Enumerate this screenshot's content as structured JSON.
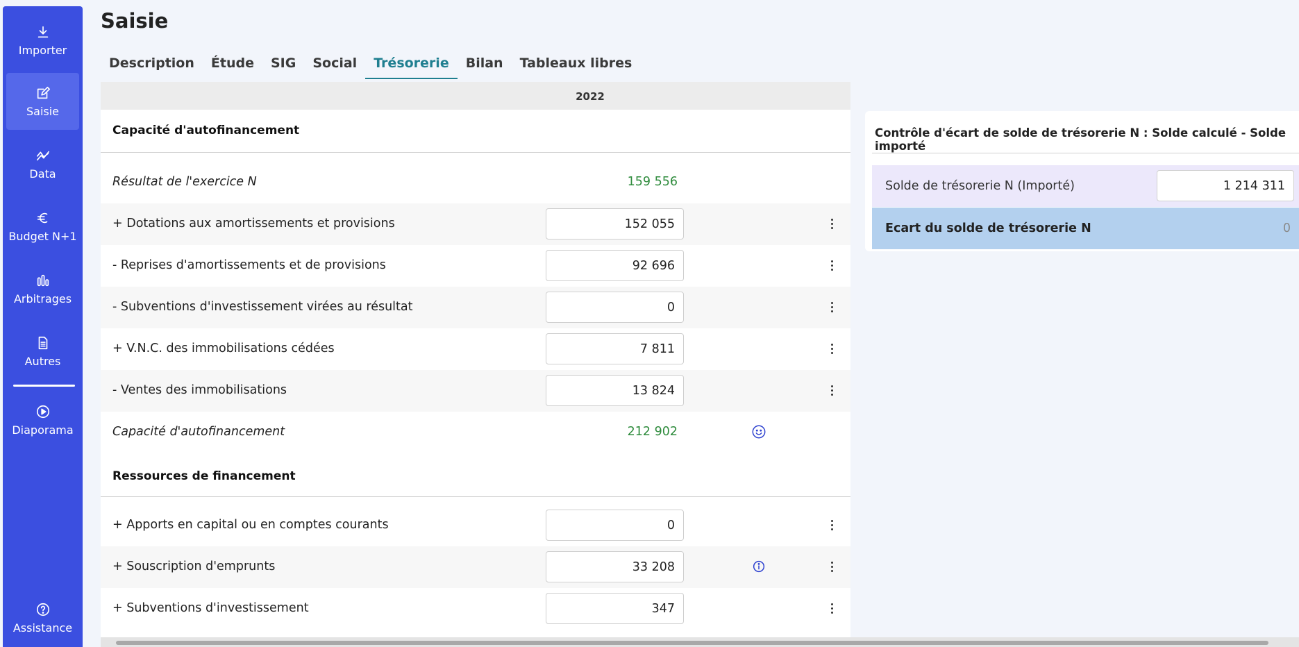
{
  "sidebar": {
    "items": [
      {
        "label": "Importer",
        "icon": "download-icon"
      },
      {
        "label": "Saisie",
        "icon": "edit-icon"
      },
      {
        "label": "Data",
        "icon": "chart-line-icon"
      },
      {
        "label": "Budget N+1",
        "icon": "euro-icon"
      },
      {
        "label": "Arbitrages",
        "icon": "bars-icon"
      },
      {
        "label": "Autres",
        "icon": "document-icon"
      },
      {
        "label": "Diaporama",
        "icon": "play-icon"
      },
      {
        "label": "Assistance",
        "icon": "help-icon"
      }
    ]
  },
  "page": {
    "title": "Saisie"
  },
  "tabs": [
    {
      "label": "Description"
    },
    {
      "label": "Étude"
    },
    {
      "label": "SIG"
    },
    {
      "label": "Social"
    },
    {
      "label": "Trésorerie"
    },
    {
      "label": "Bilan"
    },
    {
      "label": "Tableaux libres"
    }
  ],
  "active_tab": "Trésorerie",
  "table": {
    "year_header": "2022",
    "section1": "Capacité d'autofinancement",
    "rows1": [
      {
        "label": "Résultat de l'exercice N",
        "value": "159 556"
      },
      {
        "label": "+ Dotations aux amortissements et provisions",
        "value": "152 055"
      },
      {
        "label": "- Reprises d'amortissements et de provisions",
        "value": "92 696"
      },
      {
        "label": "- Subventions d'investissement virées au résultat",
        "value": "0"
      },
      {
        "label": "+ V.N.C. des immobilisations cédées",
        "value": "7 811"
      },
      {
        "label": "- Ventes des immobilisations",
        "value": "13 824"
      },
      {
        "label": "Capacité d'autofinancement",
        "value": "212 902"
      }
    ],
    "section2": "Ressources de financement",
    "rows2": [
      {
        "label": "+ Apports en capital ou en comptes courants",
        "value": "0"
      },
      {
        "label": "+ Souscription d'emprunts",
        "value": "33 208"
      },
      {
        "label": "+ Subventions d'investissement",
        "value": "347"
      }
    ]
  },
  "control": {
    "title": "Contrôle d'écart de solde de trésorerie N :  Solde calculé - Solde importé",
    "row1_label": "Solde de trésorerie N (Importé)",
    "row1_value": "1 214 311",
    "row2_label": "Ecart du solde de trésorerie N",
    "row2_value": "0"
  },
  "colors": {
    "sidebar": "#3b4fe0",
    "active_tab": "#1f7f90",
    "calc_value": "#2e8b3c",
    "control_row1": "#ece8fb",
    "control_row2": "#b3d0ee"
  }
}
